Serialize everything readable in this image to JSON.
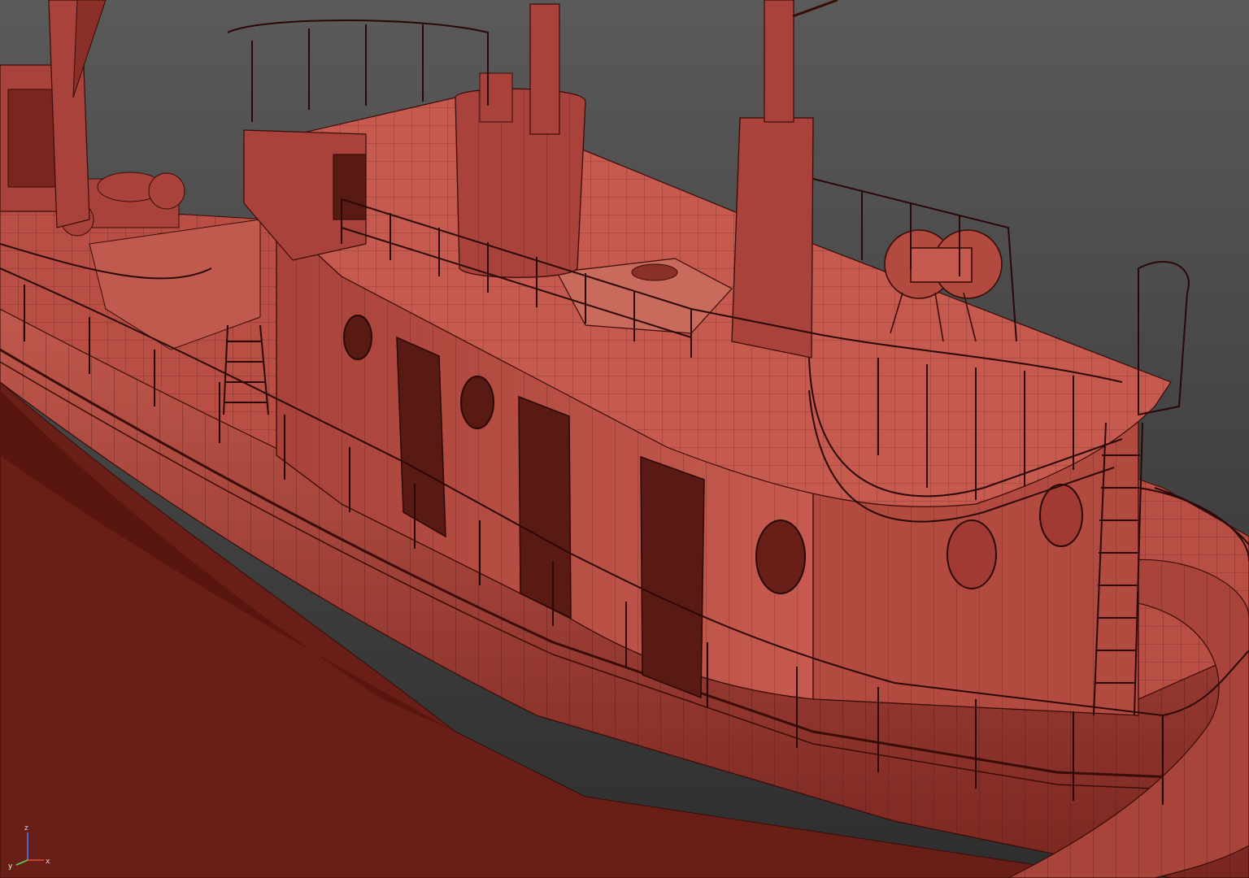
{
  "viewport": {
    "background_top": "#5a5a5a",
    "background_bottom": "#2e2e2e",
    "model_fill": "#b24a40",
    "model_fill_light": "#c65a4e",
    "model_fill_dark": "#7a2620",
    "wire_color": "#3a0c08"
  },
  "axis_gizmo": {
    "z_label": "z",
    "y_label": "y",
    "x_label": "x",
    "z_color": "#4a7cff",
    "x_color": "#e84a3a",
    "y_color": "#5ad25a"
  }
}
